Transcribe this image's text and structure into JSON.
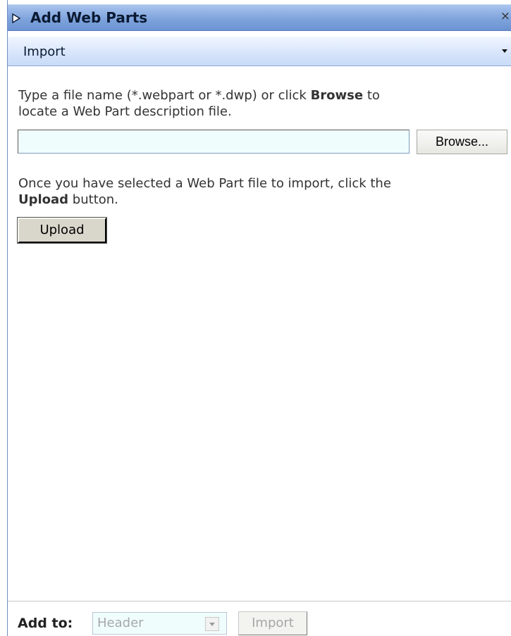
{
  "header": {
    "title": "Add Web Parts",
    "expand_icon": "triangle-right-icon",
    "close_glyph": "×"
  },
  "subheader": {
    "label": "Import",
    "menu_icon": "triangle-down-icon"
  },
  "instructions": {
    "file_prefix": "Type a file name (*.webpart or *.dwp) or click ",
    "file_bold": "Browse",
    "file_suffix": " to",
    "file_line2": "locate a Web Part description file.",
    "upload_prefix": "Once you have selected a Web Part file to import, click the",
    "upload_bold": "Upload",
    "upload_suffix": " button."
  },
  "file_input": {
    "value": ""
  },
  "buttons": {
    "browse": "Browse...",
    "upload": "Upload",
    "import": "Import"
  },
  "footer": {
    "add_to_label": "Add to:",
    "zone_selected": "Header"
  },
  "colors": {
    "titlebar": "#7fa4dc",
    "input_bg": "#f0fdfd",
    "disabled_text": "#a6a6a6"
  }
}
